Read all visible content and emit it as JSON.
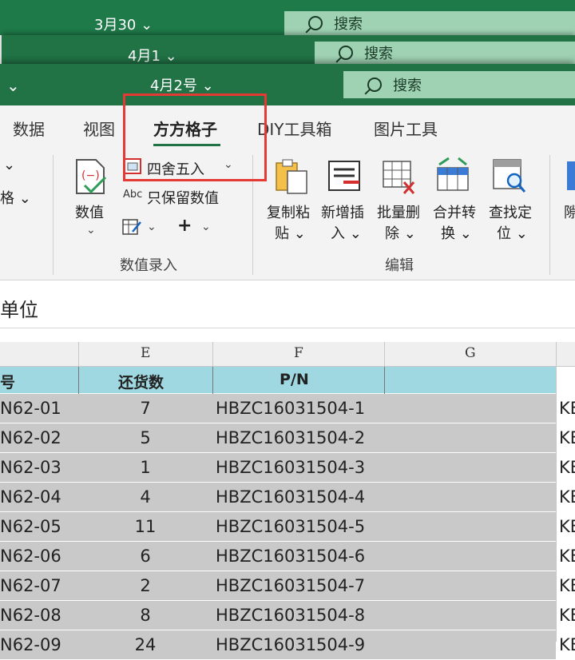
{
  "windows": [
    {
      "title": "3月30 ⌄",
      "search": "搜索"
    },
    {
      "title": "4月1 ⌄",
      "search": "搜索"
    },
    {
      "title": "4月2号 ⌄",
      "search": "搜索"
    }
  ],
  "tabs": [
    "数据",
    "视图",
    "方方格子",
    "DIY工具箱",
    "图片工具"
  ],
  "ribbon": {
    "left_partial": [
      "⌄",
      "格 ⌄"
    ],
    "numeric_group": {
      "value_btn": "数值",
      "round_btn": "四舍五入",
      "keep_values": "只保留数值",
      "abc": "Abc",
      "label": "数值录入"
    },
    "edit_group": {
      "copy_paste": [
        "复制粘",
        "贴 ⌄"
      ],
      "add_insert": [
        "新增插",
        "入 ⌄"
      ],
      "batch_delete": [
        "批量删",
        "除 ⌄"
      ],
      "merge_convert": [
        "合并转",
        "换 ⌄"
      ],
      "find_locate": [
        "查找定",
        "位 ⌄"
      ],
      "label": "编辑"
    },
    "right_partial": "隙"
  },
  "formula_bar": {
    "value": "单位"
  },
  "columns": [
    "E",
    "F",
    "G"
  ],
  "table": {
    "headers": [
      "号",
      "还货数",
      "P/N"
    ],
    "rows": [
      {
        "code": "N62-01",
        "qty": "7",
        "pn": "HBZC16031504-1",
        "k": "KE"
      },
      {
        "code": "N62-02",
        "qty": "5",
        "pn": "HBZC16031504-2",
        "k": "KE"
      },
      {
        "code": "N62-03",
        "qty": "1",
        "pn": "HBZC16031504-3",
        "k": "KE"
      },
      {
        "code": "N62-04",
        "qty": "4",
        "pn": "HBZC16031504-4",
        "k": "KE"
      },
      {
        "code": "N62-05",
        "qty": "11",
        "pn": "HBZC16031504-5",
        "k": "KE"
      },
      {
        "code": "N62-06",
        "qty": "6",
        "pn": "HBZC16031504-6",
        "k": "KE"
      },
      {
        "code": "N62-07",
        "qty": "2",
        "pn": "HBZC16031504-7",
        "k": "KE"
      },
      {
        "code": "N62-08",
        "qty": "8",
        "pn": "HBZC16031504-8",
        "k": "KE"
      },
      {
        "code": "N62-09",
        "qty": "24",
        "pn": "HBZC16031504-9",
        "k": "KE"
      }
    ]
  },
  "colors": {
    "ribbon_green": "#217346",
    "highlight_red": "#e53935",
    "header_cyan": "#9fd8e0",
    "cell_gray": "#c9c9c9"
  }
}
